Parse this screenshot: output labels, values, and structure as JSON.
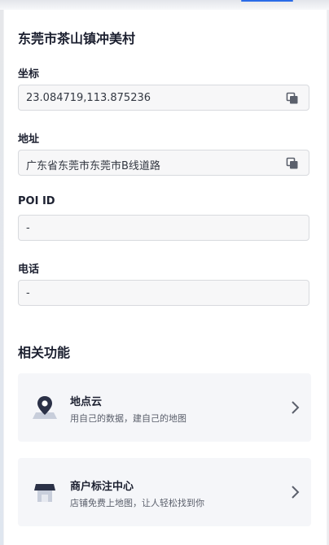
{
  "place": {
    "title": "东莞市茶山镇冲美村"
  },
  "fields": {
    "coords": {
      "label": "坐标",
      "value": "23.084719,113.875236"
    },
    "address": {
      "label": "地址",
      "value": "广东省东莞市东莞市B线道路"
    },
    "poi": {
      "label": "POI ID",
      "value": "-"
    },
    "phone": {
      "label": "电话",
      "value": "-"
    }
  },
  "related": {
    "title": "相关功能",
    "cards": [
      {
        "title": "地点云",
        "desc": "用自己的数据，建自己的地图",
        "icon": "map-pin-icon"
      },
      {
        "title": "商户标注中心",
        "desc": "店铺免费上地图，让人轻松找到你",
        "icon": "storefront-icon"
      }
    ]
  },
  "icons": {
    "copy": "copy-icon",
    "chevron": "chevron-right-icon"
  },
  "colors": {
    "accent": "#2a6be7",
    "icon_dark": "#2b3147",
    "card_bg": "#f5f6f9"
  }
}
